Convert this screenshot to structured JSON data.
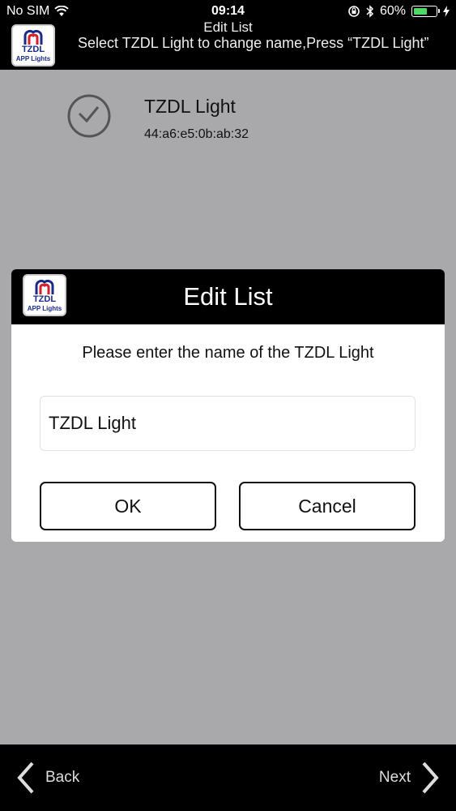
{
  "status_bar": {
    "carrier": "No SIM",
    "time": "09:14",
    "battery_percent": "60%",
    "battery_level": 0.6,
    "battery_color": "#4cd964"
  },
  "header": {
    "title": "Edit List",
    "subtitle": "Select TZDL Light to change name,Press “TZDL Light”"
  },
  "logo": {
    "line1": "TZDL",
    "line2": "APP Lights"
  },
  "device": {
    "name": "TZDL Light",
    "mac": "44:a6:e5:0b:ab:32"
  },
  "dialog": {
    "title": "Edit List",
    "prompt": "Please enter the name of the TZDL Light",
    "input_value": "TZDL Light",
    "ok_label": "OK",
    "cancel_label": "Cancel"
  },
  "bottom_bar": {
    "back_label": "Back",
    "next_label": "Next"
  },
  "icons": {
    "wifi": "wifi-icon",
    "orientation_lock": "orientation-lock-icon",
    "bluetooth": "bluetooth-icon",
    "battery": "battery-icon",
    "charging": "charging-bolt-icon",
    "clock": "clock-icon",
    "back": "chevron-left-icon",
    "next": "chevron-right-icon"
  }
}
